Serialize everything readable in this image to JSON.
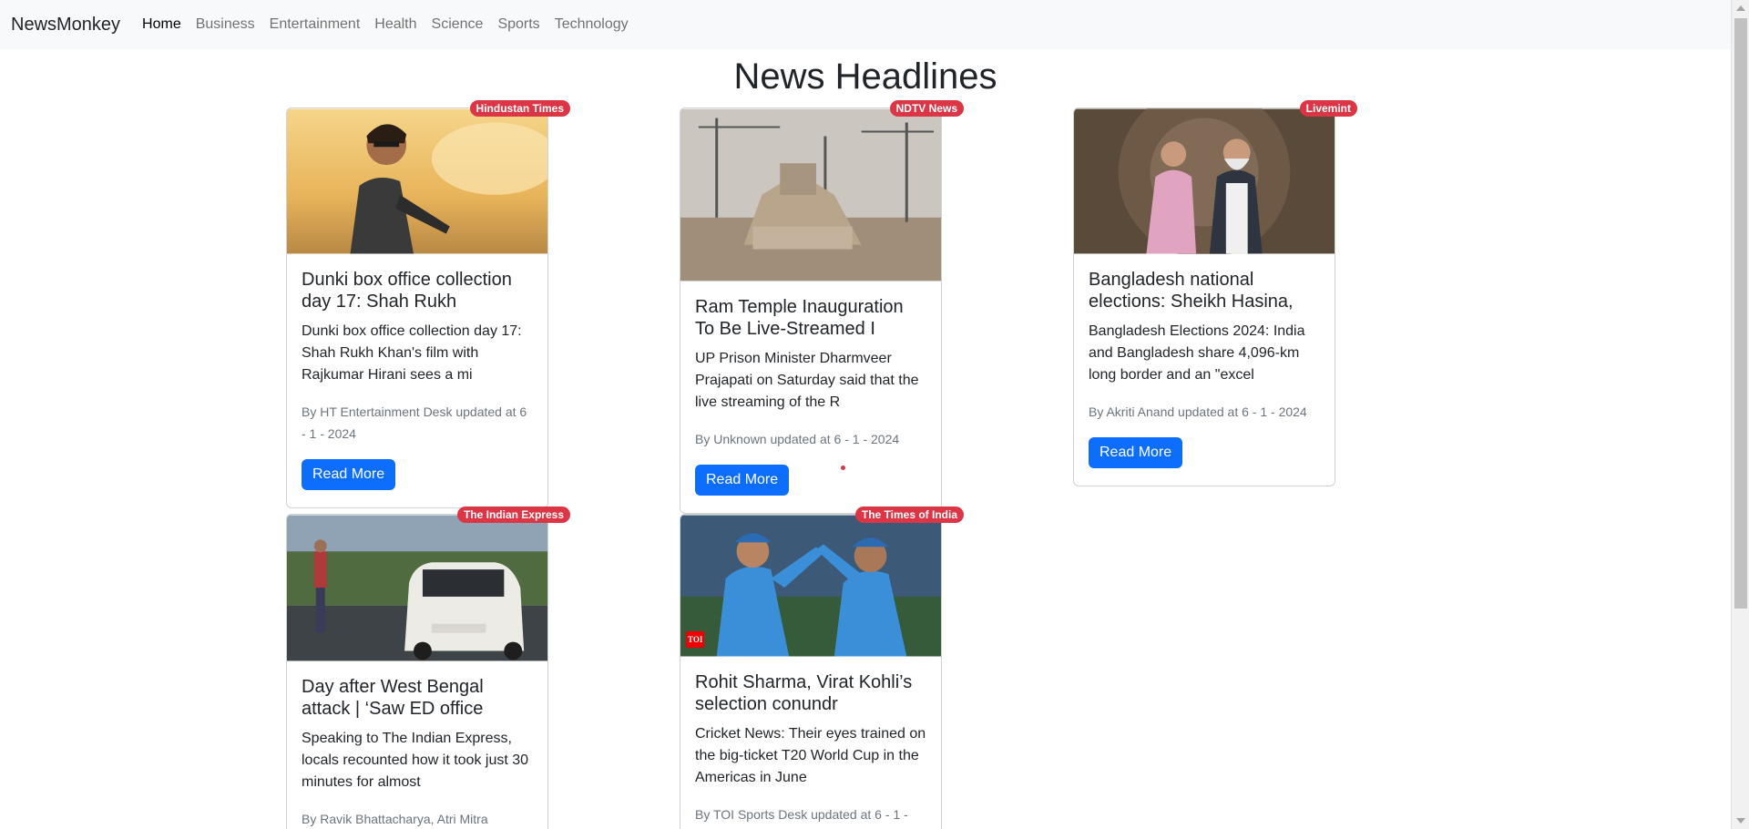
{
  "navbar": {
    "brand": "NewsMonkey",
    "links": [
      "Home",
      "Business",
      "Entertainment",
      "Health",
      "Science",
      "Sports",
      "Technology"
    ]
  },
  "page_title": "News Headlines",
  "read_more_label": "Read More",
  "cards": [
    {
      "source": "Hindustan Times",
      "title": "Dunki box office collection day 17: Shah Rukh",
      "description": "Dunki box office collection day 17: Shah Rukh Khan's film with Rajkumar Hirani sees a mi",
      "meta": "By HT Entertainment Desk updated at 6 - 1 - 2024"
    },
    {
      "source": "NDTV News",
      "title": "Ram Temple Inauguration To Be Live-Streamed I",
      "description": "UP Prison Minister Dharmveer Prajapati on Saturday said that the live streaming of the R",
      "meta": "By Unknown updated at 6 - 1 - 2024"
    },
    {
      "source": "Livemint",
      "title": "Bangladesh national elections: Sheikh Hasina,",
      "description": "Bangladesh Elections 2024: India and Bangladesh share 4,096-km long border and an \"excel",
      "meta": "By Akriti Anand updated at 6 - 1 - 2024"
    },
    {
      "source": "The Indian Express",
      "title": "Day after West Bengal attack | ‘Saw ED office",
      "description": "Speaking to The Indian Express, locals recounted how it took just 30 minutes for almost",
      "meta": "By Ravik Bhattacharya, Atri Mitra"
    },
    {
      "source": "The Times of India",
      "title": "Rohit Sharma, Virat Kohli’s selection conundr",
      "description": "Cricket News: Their eyes trained on the big-ticket T20 World Cup in the Americas in June",
      "meta": "By TOI Sports Desk updated at 6 - 1 -",
      "image_logo": "TOI"
    }
  ],
  "colors": {
    "navbar_bg": "#f8f9fa",
    "badge": "#dc3545",
    "button": "#0d6efd",
    "meta_text": "#6c757d"
  }
}
